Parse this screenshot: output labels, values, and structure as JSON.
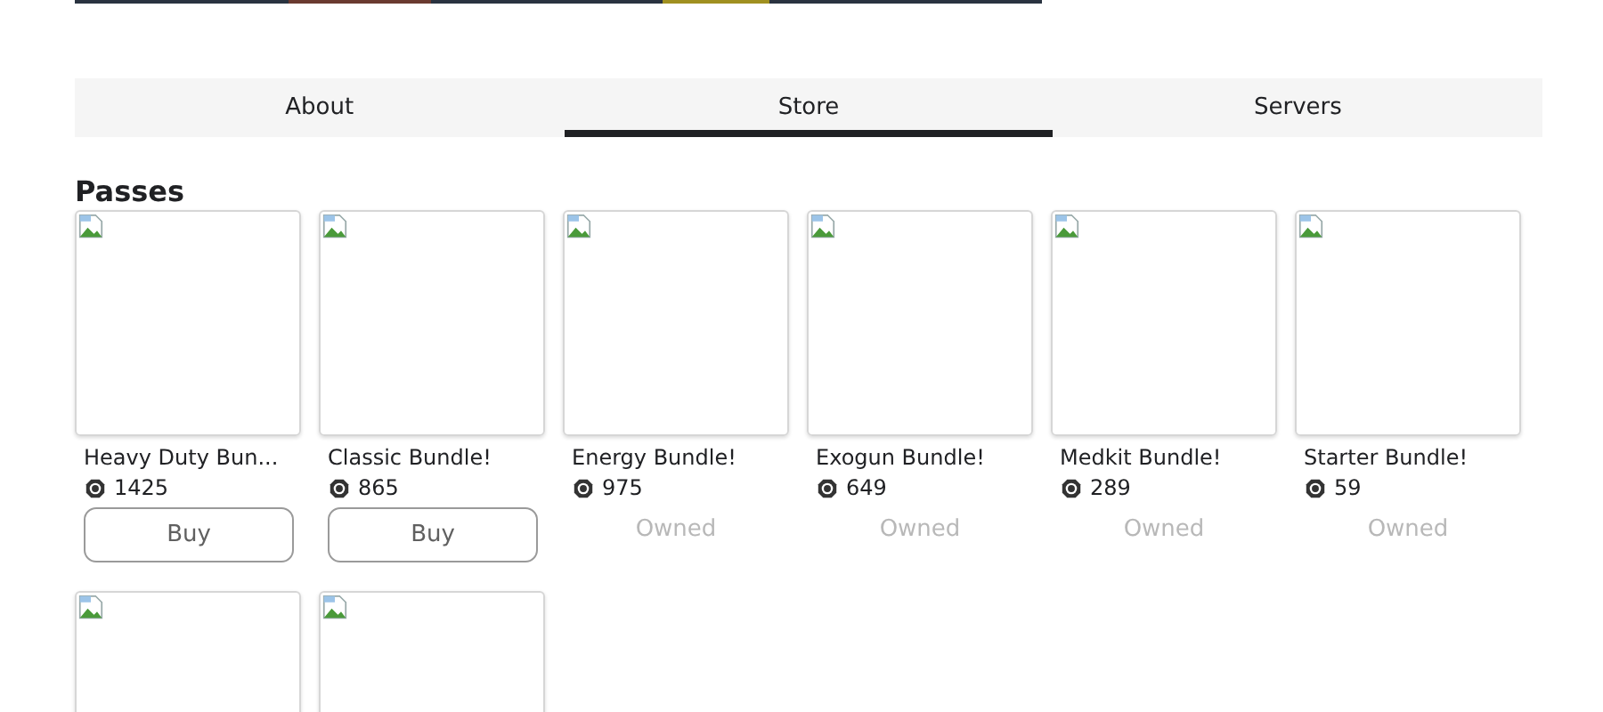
{
  "tabs": [
    {
      "label": "About",
      "selected": false
    },
    {
      "label": "Store",
      "selected": true
    },
    {
      "label": "Servers",
      "selected": false
    }
  ],
  "section_title": "Passes",
  "passes": [
    {
      "kind": "pass",
      "name": "Heavy Duty Bun...",
      "price": "1425",
      "action": {
        "kind": "button",
        "label": "Buy"
      }
    },
    {
      "kind": "pass",
      "name": "Classic Bundle!",
      "price": "865",
      "action": {
        "kind": "button",
        "label": "Buy"
      }
    },
    {
      "kind": "pass",
      "name": "Energy Bundle!",
      "price": "975",
      "action": {
        "kind": "status",
        "label": "Owned"
      }
    },
    {
      "kind": "pass",
      "name": "Exogun Bundle!",
      "price": "649",
      "action": {
        "kind": "status",
        "label": "Owned"
      }
    },
    {
      "kind": "pass",
      "name": "Medkit Bundle!",
      "price": "289",
      "action": {
        "kind": "status",
        "label": "Owned"
      }
    },
    {
      "kind": "pass",
      "name": "Starter Bundle!",
      "price": "59",
      "action": {
        "kind": "status",
        "label": "Owned"
      }
    },
    {
      "kind": "thumbnail"
    },
    {
      "kind": "thumbnail"
    }
  ]
}
